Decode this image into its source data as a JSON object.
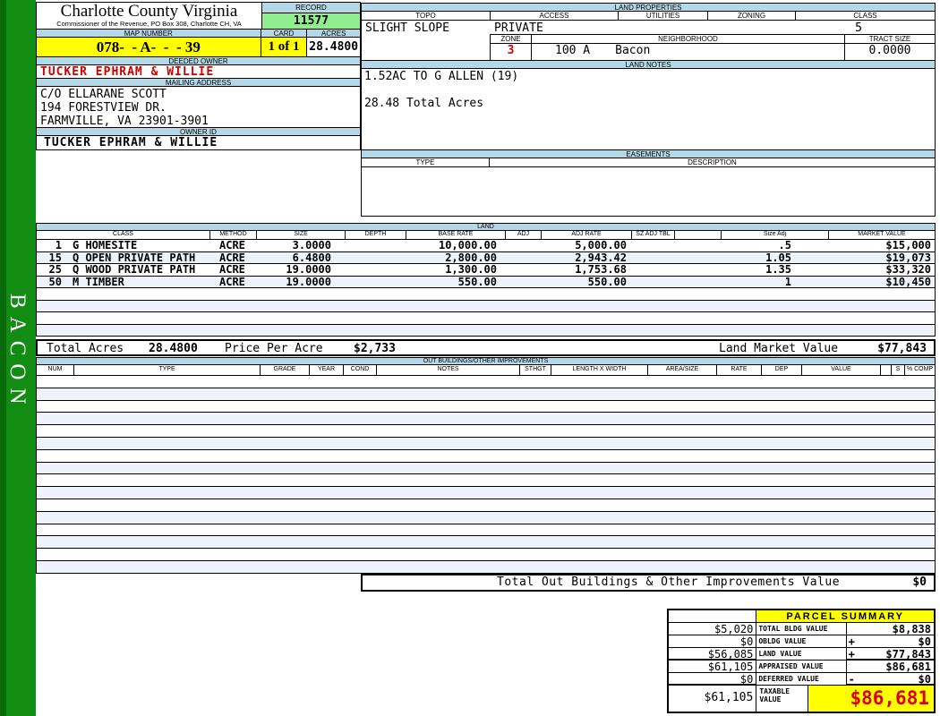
{
  "sidebar": {
    "vertical_label": "BACON"
  },
  "header": {
    "county_title": "Charlotte County Virginia",
    "county_subtitle": "Commissioner of the Revenue, PO Box 308, Charlotte CH, VA",
    "record_label": "RECORD",
    "record_value": "11577",
    "map_number_label": "MAP NUMBER",
    "map_number_value": "078-  - A-  -  - 39",
    "card_label": "CARD",
    "card_value": "1 of 1",
    "acres_label": "ACRES",
    "acres_value": "28.4800"
  },
  "owner": {
    "deeded_owner_label": "DEEDED OWNER",
    "deeded_owner": "TUCKER EPHRAM & WILLIE",
    "mailing_address_label": "MAILING ADDRESS",
    "mailing_address_lines": [
      "C/O ELLARANE SCOTT",
      "194 FORESTVIEW DR.",
      "FARMVILLE, VA 23901-3901"
    ],
    "owner_id_label": "OWNER ID",
    "owner_id": "TUCKER EPHRAM & WILLIE"
  },
  "land_properties": {
    "title": "LAND PROPERTIES",
    "columns": [
      "TOPO",
      "ACCESS",
      "UTILITIES",
      "ZONING",
      "CLASS"
    ],
    "topo": "SLIGHT SLOPE",
    "access": "PRIVATE",
    "utilities": "",
    "zoning": "",
    "class": "5",
    "zone_label": "ZONE",
    "zone": "3",
    "neighborhood_label": "NEIGHBORHOOD",
    "neighborhood_code": "100 A",
    "neighborhood_name": "Bacon",
    "tract_size_label": "TRACT SIZE",
    "tract_size": "0.0000"
  },
  "land_notes": {
    "title": "LAND NOTES",
    "lines": [
      "1.52AC TO G ALLEN (19)",
      "28.48 Total Acres"
    ]
  },
  "easements": {
    "title": "EASEMENTS",
    "columns": [
      "TYPE",
      "DESCRIPTION"
    ]
  },
  "land_table": {
    "title": "LAND",
    "columns": [
      "CLASS",
      "METHOD",
      "SIZE",
      "DEPTH",
      "BASE RATE",
      "ADJ",
      "ADJ RATE",
      "SZ ADJ TBL",
      "",
      "Size Adj",
      "MARKET VALUE"
    ],
    "rows": [
      {
        "num": "1",
        "class": "G HOMESITE",
        "method": "ACRE",
        "size": "3.0000",
        "depth": "",
        "base_rate": "10,000.00",
        "adj": "",
        "adj_rate": "5,000.00",
        "sz_adj_tbl": "",
        "size_adj": ".5",
        "market_value": "$15,000"
      },
      {
        "num": "15",
        "class": "Q OPEN PRIVATE PATH",
        "method": "ACRE",
        "size": "6.4800",
        "depth": "",
        "base_rate": "2,800.00",
        "adj": "",
        "adj_rate": "2,943.42",
        "sz_adj_tbl": "",
        "size_adj": "1.05",
        "market_value": "$19,073"
      },
      {
        "num": "25",
        "class": "Q WOOD PRIVATE PATH",
        "method": "ACRE",
        "size": "19.0000",
        "depth": "",
        "base_rate": "1,300.00",
        "adj": "",
        "adj_rate": "1,753.68",
        "sz_adj_tbl": "",
        "size_adj": "1.35",
        "market_value": "$33,320"
      },
      {
        "num": "50",
        "class": "M TIMBER",
        "method": "ACRE",
        "size": "19.0000",
        "depth": "",
        "base_rate": "550.00",
        "adj": "",
        "adj_rate": "550.00",
        "sz_adj_tbl": "",
        "size_adj": "1",
        "market_value": "$10,450"
      }
    ],
    "totals": {
      "total_acres_label": "Total Acres",
      "total_acres": "28.4800",
      "price_per_acre_label": "Price Per Acre",
      "price_per_acre": "$2,733",
      "land_market_value_label": "Land Market Value",
      "land_market_value": "$77,843"
    }
  },
  "out_buildings": {
    "title": "OUT BUILDINGS/OTHER IMPROVEMENTS",
    "columns": [
      "NUM",
      "TYPE",
      "GRADE",
      "YEAR",
      "COND",
      "NOTES",
      "STHGT",
      "LENGTH X WIDTH",
      "AREA/SIZE",
      "RATE",
      "DEP",
      "VALUE",
      "",
      "S",
      "% COMP"
    ],
    "total_label": "Total Out Buildings & Other Improvements Value",
    "total_value": "$0"
  },
  "parcel_summary": {
    "title": "PARCEL SUMMARY",
    "rows": [
      {
        "prior": "$5,020",
        "label": "TOTAL BLDG VALUE",
        "op": "",
        "value": "$8,838"
      },
      {
        "prior": "$0",
        "label": "OBLDG VALUE",
        "op": "+",
        "value": "$0"
      },
      {
        "prior": "$56,085",
        "label": "LAND VALUE",
        "op": "+",
        "value": "$77,843"
      },
      {
        "prior": "$61,105",
        "label": "APPRAISED VALUE",
        "op": "",
        "value": "$86,681"
      },
      {
        "prior": "$0",
        "label": "DEFERRED VALUE",
        "op": "-",
        "value": "$0"
      },
      {
        "prior": "$61,105",
        "label": "TAXABLE VALUE",
        "op": "",
        "value": "$86,681"
      }
    ]
  },
  "colors": {
    "sidebar_green": "#128c12",
    "header_blue": "#b5d8e8",
    "record_green": "#90ee90",
    "highlight_yellow": "#ffff00",
    "alert_red": "#cc0000",
    "row_stripe": "#eef2fa"
  }
}
